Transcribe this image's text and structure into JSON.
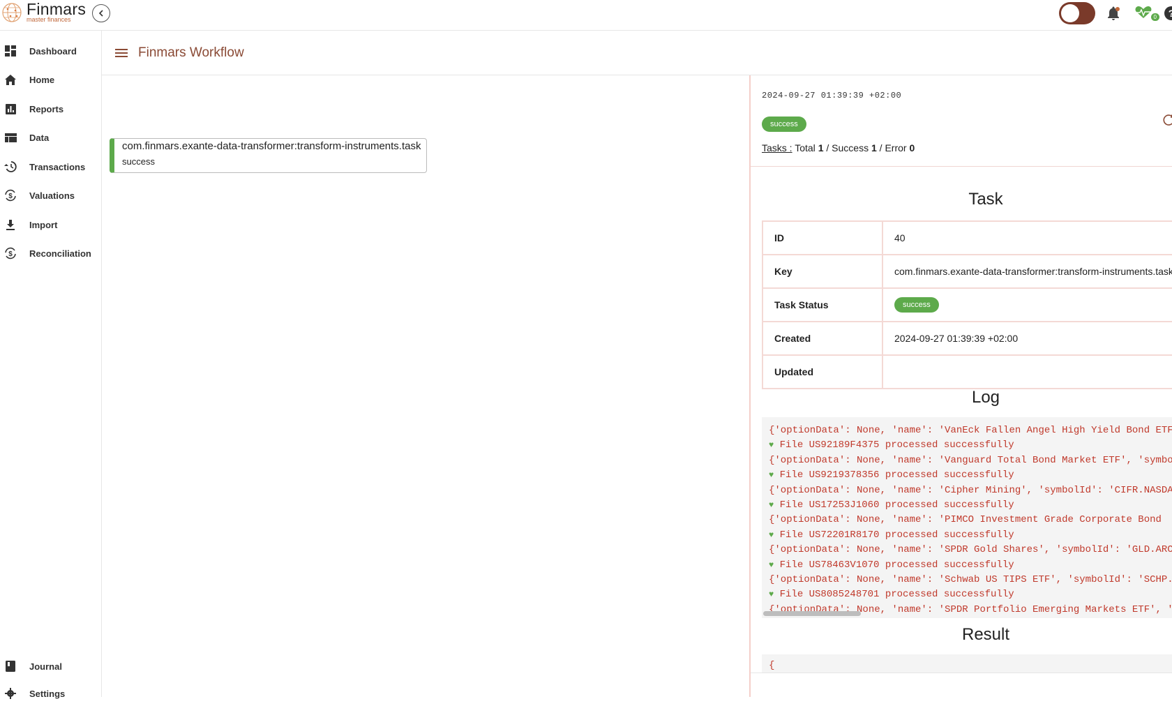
{
  "app": {
    "name": "Finmars",
    "tagline": "master finances",
    "health_count": "0"
  },
  "sidebar": {
    "items": [
      {
        "label": "Dashboard",
        "icon": "dashboard-icon"
      },
      {
        "label": "Home",
        "icon": "home-icon"
      },
      {
        "label": "Reports",
        "icon": "reports-icon"
      },
      {
        "label": "Data",
        "icon": "data-icon"
      },
      {
        "label": "Transactions",
        "icon": "history-icon"
      },
      {
        "label": "Valuations",
        "icon": "valuation-icon"
      },
      {
        "label": "Import",
        "icon": "download-icon"
      },
      {
        "label": "Reconciliation",
        "icon": "reconciliation-icon"
      }
    ],
    "bottom_items": [
      {
        "label": "Journal",
        "icon": "book-icon"
      },
      {
        "label": "Settings",
        "icon": "gear-icon"
      }
    ]
  },
  "header": {
    "title": "Finmars Workflow"
  },
  "workflow": {
    "node": {
      "title": "com.finmars.exante-data-transformer:transform-instruments.task",
      "status": "success"
    }
  },
  "panel": {
    "date": "2024-09-27 01:39:39 +02:00",
    "status": "success",
    "tasks_label": "Tasks :",
    "total_label": "Total",
    "total": "1",
    "success_label": "Success",
    "success": "1",
    "error_label": "Error",
    "error": "0",
    "task_section_title": "Task",
    "task_fields": [
      {
        "label": "ID",
        "value": "40"
      },
      {
        "label": "Key",
        "value": "com.finmars.exante-data-transformer:transform-instruments.task"
      },
      {
        "label": "Task Status",
        "value": "success"
      },
      {
        "label": "Created",
        "value": "2024-09-27 01:39:39 +02:00"
      },
      {
        "label": "Updated",
        "value": ""
      }
    ],
    "log_section_title": "Log",
    "log_lines": [
      "{'optionData': None, 'name': 'VanEck Fallen Angel High Yield Bond ETF'",
      "File US92189F4375 processed successfully",
      "{'optionData': None, 'name': 'Vanguard Total Bond Market ETF', 'symbolId'",
      "File US9219378356 processed successfully",
      "{'optionData': None, 'name': 'Cipher Mining', 'symbolId': 'CIFR.NASDAQ'",
      "File US17253J1060 processed successfully",
      "{'optionData': None, 'name': 'PIMCO Investment Grade Corporate Bond",
      "File US72201R8170 processed successfully",
      "{'optionData': None, 'name': 'SPDR Gold Shares', 'symbolId': 'GLD.ARCA'",
      "File US78463V1070 processed successfully",
      "{'optionData': None, 'name': 'Schwab US TIPS ETF', 'symbolId': 'SCHP.",
      "File US8085248701 processed successfully",
      "{'optionData': None, 'name': 'SPDR Portfolio Emerging Markets ETF', 'sym"
    ],
    "result_section_title": "Result",
    "result_first_line": "{"
  },
  "colors": {
    "accent": "#8a4a35",
    "success": "#5daa4b",
    "log_text": "#c0392b",
    "panel_border": "#f4cfca"
  }
}
